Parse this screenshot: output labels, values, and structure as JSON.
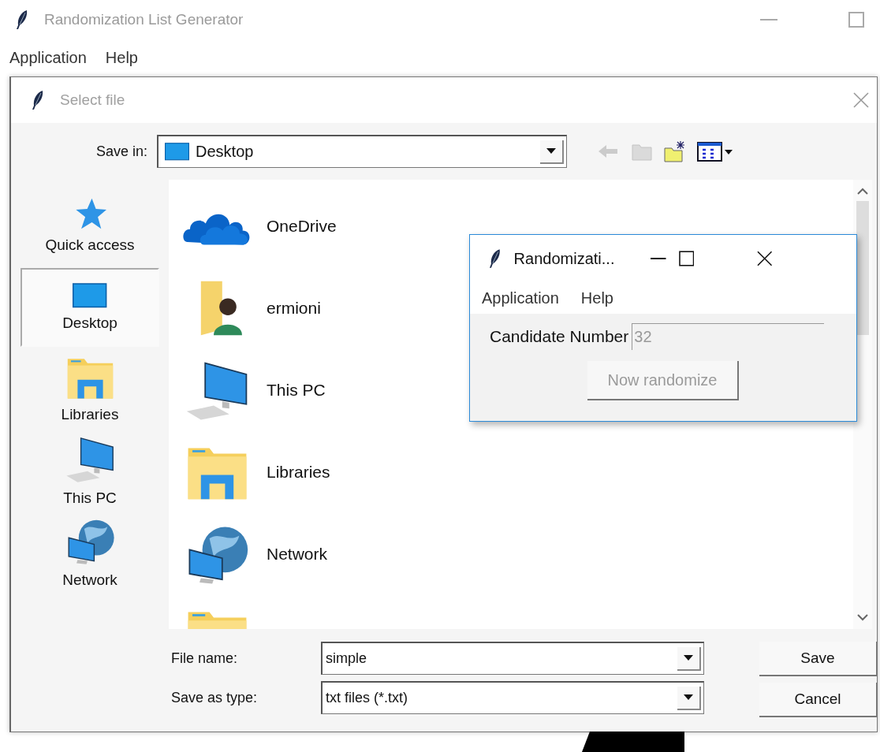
{
  "main_window": {
    "title": "Randomization List Generator",
    "menu": [
      "Application",
      "Help"
    ]
  },
  "dialog": {
    "title": "Select file",
    "save_in": {
      "label": "Save in:",
      "value": "Desktop"
    },
    "toolbar": [
      {
        "kind": "back",
        "disabled": true
      },
      {
        "kind": "up",
        "disabled": true
      },
      {
        "kind": "new_folder",
        "disabled": false
      },
      {
        "kind": "view_menu",
        "disabled": false
      }
    ],
    "places": [
      {
        "label": "Quick access",
        "kind": "star",
        "selected": false
      },
      {
        "label": "Desktop",
        "kind": "desktop",
        "selected": true
      },
      {
        "label": "Libraries",
        "kind": "libraries",
        "selected": false
      },
      {
        "label": "This PC",
        "kind": "pc",
        "selected": false
      },
      {
        "label": "Network",
        "kind": "network",
        "selected": false
      }
    ],
    "files": [
      {
        "label": "OneDrive",
        "kind": "cloud"
      },
      {
        "label": "ermioni",
        "kind": "user_folder"
      },
      {
        "label": "This PC",
        "kind": "pc"
      },
      {
        "label": "Libraries",
        "kind": "libraries"
      },
      {
        "label": "Network",
        "kind": "network"
      },
      {
        "kind": "folder"
      }
    ],
    "file_name": {
      "label": "File name:",
      "value": "simple"
    },
    "save_as_type": {
      "label": "Save as type:",
      "value": "txt files (*.txt)"
    },
    "buttons": [
      "Save",
      "Cancel"
    ]
  },
  "popup_window": {
    "title": "Randomizati...",
    "menu": [
      "Application",
      "Help"
    ],
    "field": {
      "label": "Candidate Number",
      "value": "32",
      "disabled": true
    },
    "button": {
      "label": "Now randomize",
      "disabled": true
    }
  }
}
